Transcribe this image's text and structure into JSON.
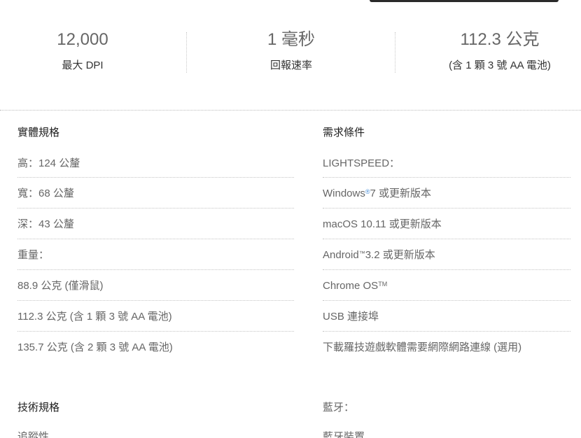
{
  "stats": [
    {
      "value": "12,000",
      "label": "最大 DPI"
    },
    {
      "value": "1 毫秒",
      "label": "回報速率"
    },
    {
      "value": "112.3 公克",
      "label": "(含 1 顆 3 號 AA 電池)"
    }
  ],
  "physical": {
    "heading": "實體規格",
    "rows": [
      "高：124 公釐",
      "寬：68 公釐",
      "深：43 公釐",
      "重量：",
      "88.9 公克 (僅滑鼠)",
      "112.3 公克 (含 1 顆 3 號 AA 電池)",
      "135.7 公克 (含 2 顆 3 號 AA 電池)"
    ]
  },
  "requirements": {
    "heading": "需求條件",
    "rows": [
      {
        "text": "LIGHTSPEED：",
        "mark": "",
        "suffix": ""
      },
      {
        "text": "Windows",
        "mark": "®",
        "suffix": " 7 或更新版本"
      },
      {
        "text": "macOS 10.11 或更新版本",
        "mark": "",
        "suffix": ""
      },
      {
        "text": "Android",
        "mark": "™",
        "suffix": " 3.2 或更新版本"
      },
      {
        "text": "Chrome OS",
        "mark": "TM",
        "suffix": ""
      },
      {
        "text": "USB 連接埠",
        "mark": "",
        "suffix": ""
      },
      {
        "text": "下載羅技遊戲軟體需要網際網路連線 (選用)",
        "mark": "",
        "suffix": ""
      }
    ]
  },
  "tech": {
    "heading": "技術規格",
    "next": "追蹤性"
  },
  "bluetooth": {
    "heading": "藍牙：",
    "next": "藍牙裝置"
  }
}
